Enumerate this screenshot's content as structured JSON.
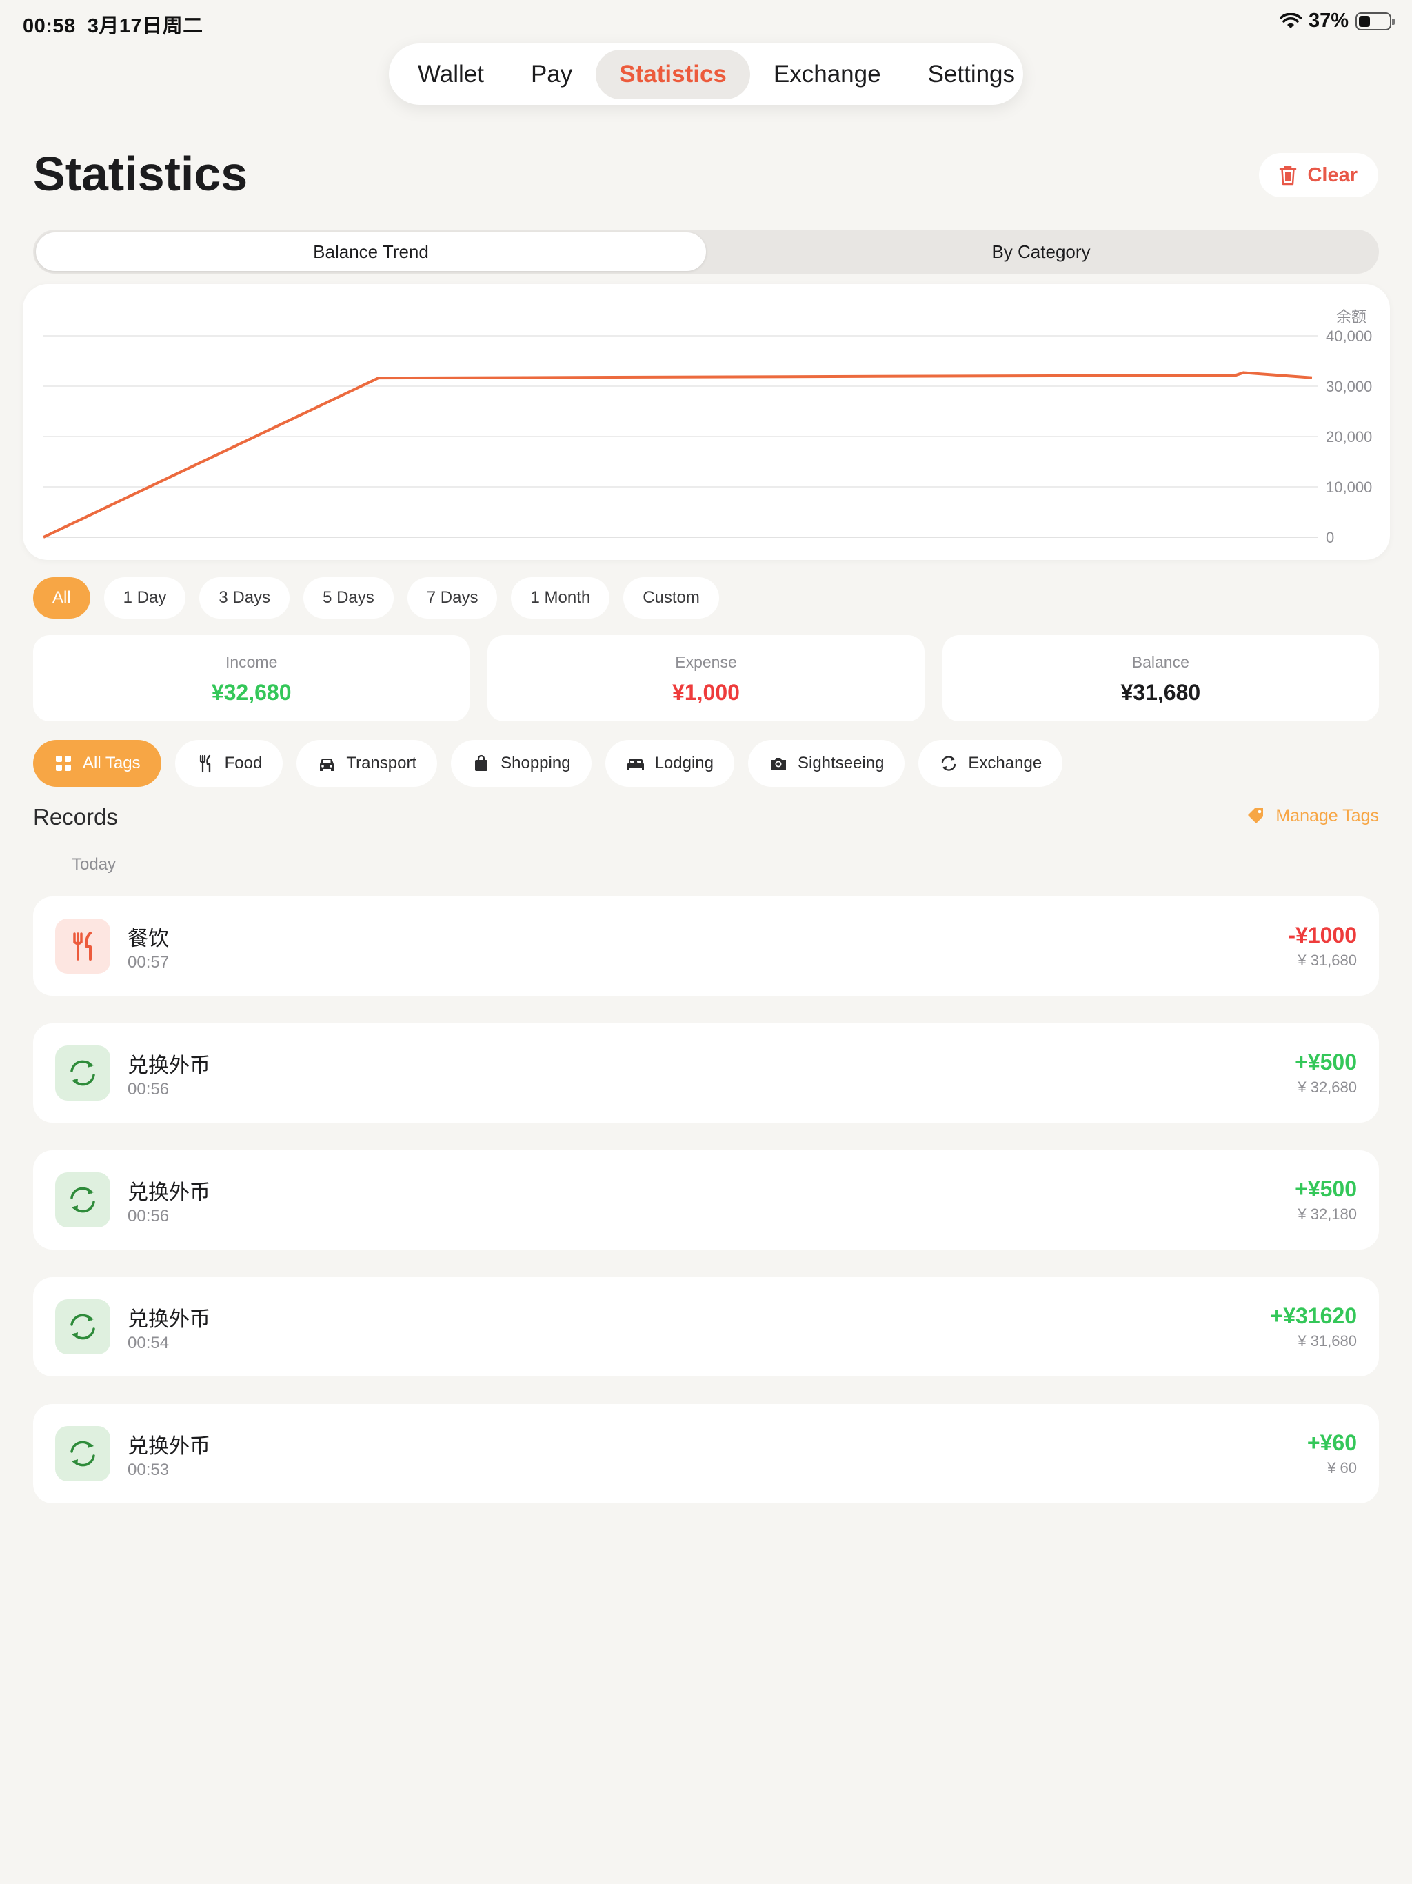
{
  "status_bar": {
    "time": "00:58",
    "date": "3月17日周二",
    "battery": "37%",
    "battery_level": 0.37
  },
  "nav": {
    "items": [
      "Wallet",
      "Pay",
      "Statistics",
      "Exchange",
      "Settings"
    ],
    "active": "Statistics"
  },
  "page": {
    "title": "Statistics",
    "clear_label": "Clear"
  },
  "segments": {
    "items": [
      "Balance Trend",
      "By Category"
    ],
    "active": "Balance Trend"
  },
  "chart_data": {
    "type": "line",
    "ylabel": "余额",
    "ylim": [
      0,
      40000
    ],
    "yticks": [
      "40,000",
      "30,000",
      "20,000",
      "10,000",
      "0"
    ],
    "grid": true,
    "series": [
      {
        "values": [
          0,
          31620,
          32180,
          32680,
          31680
        ],
        "color": "#ec6a3e"
      }
    ],
    "time_fractions": [
      0.0,
      0.264,
      0.94,
      0.946,
      1.0
    ]
  },
  "ranges": {
    "items": [
      "All",
      "1 Day",
      "3 Days",
      "5 Days",
      "7 Days",
      "1 Month",
      "Custom"
    ],
    "active": "All"
  },
  "summary": {
    "income_label": "Income",
    "income_value": "¥32,680",
    "expense_label": "Expense",
    "expense_value": "¥1,000",
    "balance_label": "Balance",
    "balance_value": "¥31,680"
  },
  "tags": {
    "items": [
      {
        "label": "All Tags",
        "icon": "grid-icon"
      },
      {
        "label": "Food",
        "icon": "fork-knife-icon"
      },
      {
        "label": "Transport",
        "icon": "car-icon"
      },
      {
        "label": "Shopping",
        "icon": "bag-icon"
      },
      {
        "label": "Lodging",
        "icon": "bed-icon"
      },
      {
        "label": "Sightseeing",
        "icon": "camera-icon"
      },
      {
        "label": "Exchange",
        "icon": "refresh-icon"
      }
    ],
    "active": "All Tags"
  },
  "records": {
    "title": "Records",
    "manage_tags": "Manage Tags",
    "section": "Today",
    "items": [
      {
        "title": "餐饮",
        "time": "00:57",
        "amount": "-¥1000",
        "balance": "¥ 31,680",
        "type": "expense",
        "icon": "fork-knife-icon"
      },
      {
        "title": "兑换外币",
        "time": "00:56",
        "amount": "+¥500",
        "balance": "¥ 32,680",
        "type": "income",
        "icon": "refresh-icon"
      },
      {
        "title": "兑换外币",
        "time": "00:56",
        "amount": "+¥500",
        "balance": "¥ 32,180",
        "type": "income",
        "icon": "refresh-icon"
      },
      {
        "title": "兑换外币",
        "time": "00:54",
        "amount": "+¥31620",
        "balance": "¥ 31,680",
        "type": "income",
        "icon": "refresh-icon"
      },
      {
        "title": "兑换外币",
        "time": "00:53",
        "amount": "+¥60",
        "balance": "¥ 60",
        "type": "income",
        "icon": "refresh-icon"
      }
    ]
  },
  "colors": {
    "accent": "#ec5b3c",
    "orange": "#f7a645",
    "income": "#34c759",
    "expense": "#ee3c3c"
  }
}
